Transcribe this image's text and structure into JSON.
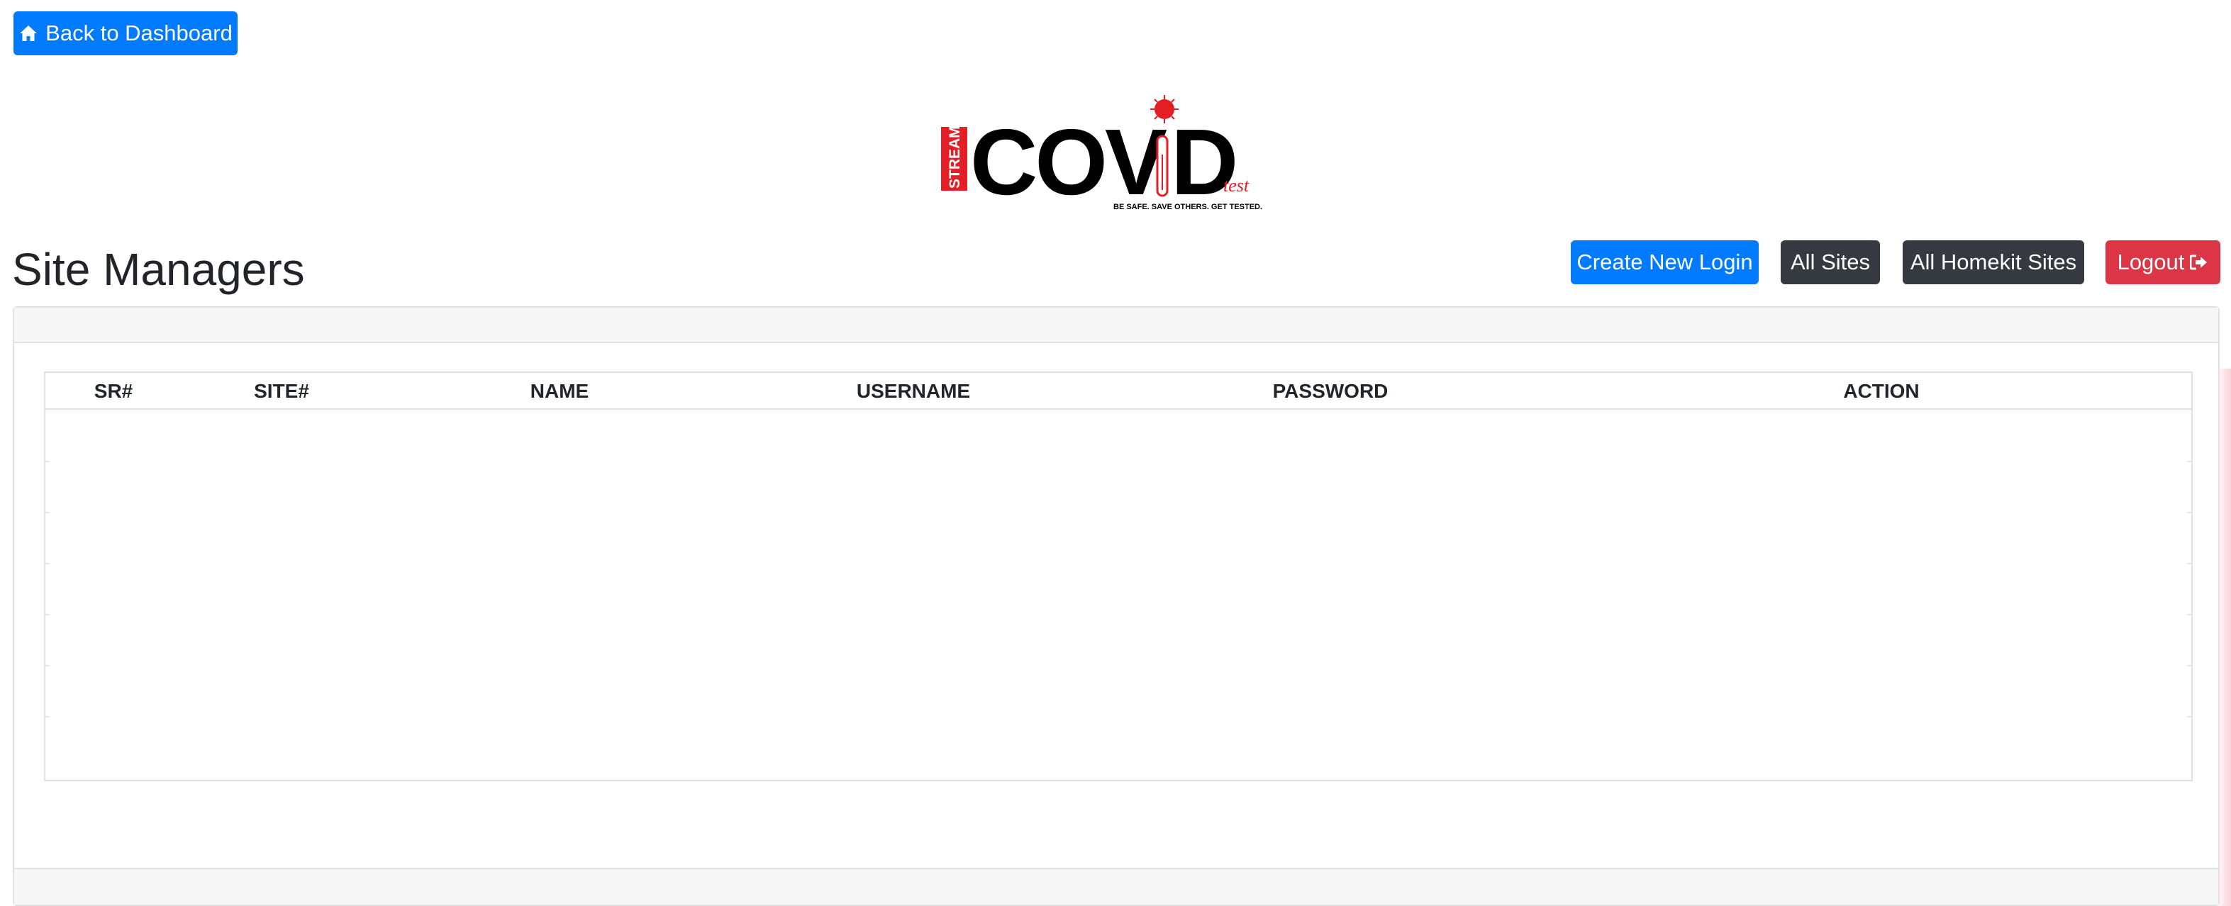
{
  "toolbar": {
    "back_label": "Back to Dashboard",
    "create_label": "Create New Login",
    "sites_label": "All Sites",
    "homekit_label": "All Homekit Sites",
    "logout_label": "Logout"
  },
  "logo": {
    "side_text": "STREAM",
    "main_text": "COVD",
    "suffix": "test",
    "tagline": "BE SAFE. SAVE OTHERS. GET TESTED."
  },
  "page": {
    "title": "Site Managers"
  },
  "table": {
    "columns": [
      "SR#",
      "SITE#",
      "NAME",
      "USERNAME",
      "PASSWORD",
      "ACTION"
    ],
    "rows": []
  },
  "colors": {
    "primary": "#007bff",
    "dark": "#343a40",
    "danger": "#dc3545",
    "logo_red": "#e31e24"
  },
  "icons": {
    "back": "home-icon",
    "logout": "sign-out-icon"
  }
}
